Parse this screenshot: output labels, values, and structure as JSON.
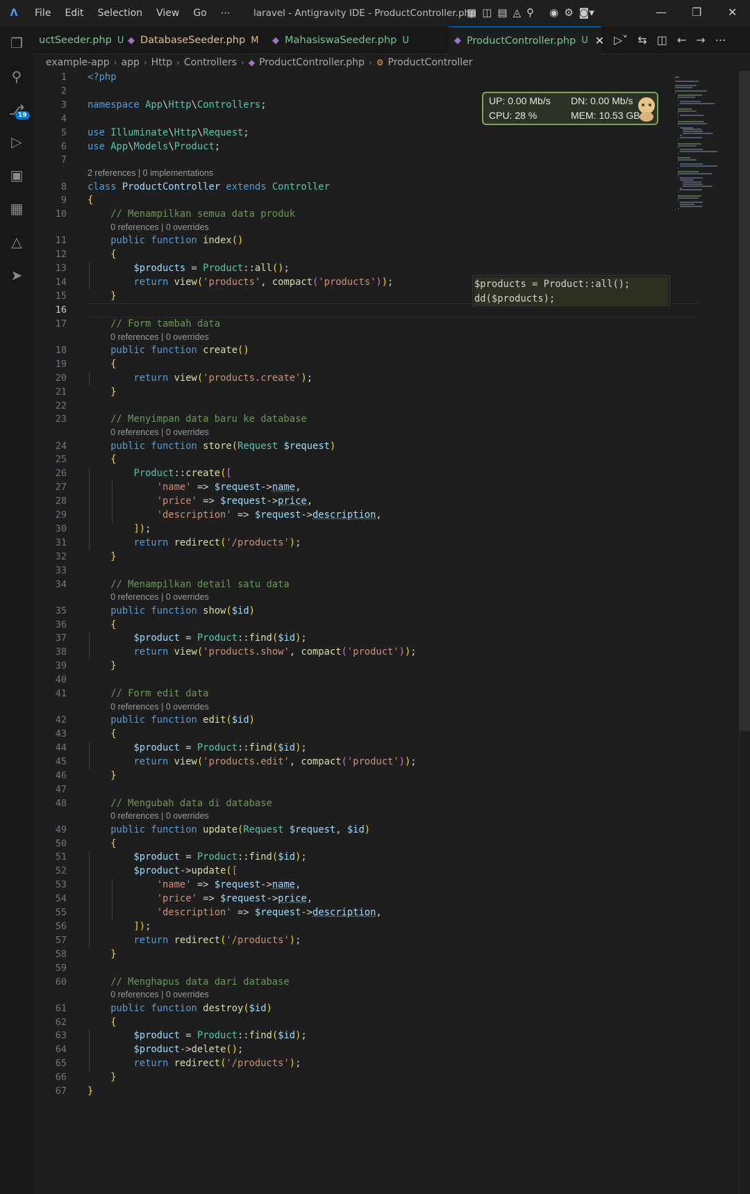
{
  "titlebar": {
    "menu": [
      "File",
      "Edit",
      "Selection",
      "View",
      "Go",
      "⋯"
    ],
    "window_title": "laravel - Antigravity IDE - ProductController.php"
  },
  "activity_bar": {
    "items": [
      "explorer-icon",
      "search-icon",
      "source-control-icon",
      "run-debug-icon",
      "remote-explorer-icon",
      "extensions-icon",
      "testing-icon",
      "deploy-icon"
    ],
    "source_control_badge": "19"
  },
  "tabs": [
    {
      "label": "uctSeeder.php",
      "status": "U",
      "status_color": "#73c991",
      "label_color": "#73c991"
    },
    {
      "label": "DatabaseSeeder.php",
      "status": "M",
      "status_color": "#e2c08d",
      "label_color": "#e2c08d"
    },
    {
      "label": "MahasiswaSeeder.php",
      "status": "U",
      "status_color": "#73c991",
      "label_color": "#73c991"
    },
    {
      "label": "ProductController.php",
      "status": "U",
      "status_color": "#73c991",
      "label_color": "#73c991",
      "active": true
    }
  ],
  "breadcrumb": [
    "example-app",
    "app",
    "Http",
    "Controllers",
    "ProductController.php",
    "ProductController"
  ],
  "code_lens": {
    "class": "2 references | 0 implementations",
    "method": "0 references | 0 overrides"
  },
  "hint_panel": {
    "line1": "$products = Product::all();",
    "line2": "dd($products);"
  },
  "system_monitor": {
    "up": "UP: 0.00 Mb/s",
    "down": "DN: 0.00 Mb/s",
    "cpu": "CPU: 28 %",
    "mem": "MEM: 10.53 GB"
  },
  "editor": {
    "current_line": 16,
    "line_numbers": [
      1,
      2,
      3,
      4,
      5,
      6,
      7,
      8,
      9,
      10,
      11,
      12,
      13,
      14,
      15,
      16,
      17,
      18,
      19,
      20,
      21,
      22,
      23,
      24,
      25,
      26,
      27,
      28,
      29,
      30,
      31,
      32,
      33,
      34,
      35,
      36,
      37,
      38,
      39,
      40,
      41,
      42,
      43,
      44,
      45,
      46,
      47,
      48,
      49,
      50,
      51,
      52,
      53,
      54,
      55,
      56,
      57,
      58,
      59,
      60,
      61,
      62,
      63,
      64,
      65,
      66,
      67
    ],
    "lines": [
      "<?php",
      "",
      "namespace App\\Http\\Controllers;",
      "",
      "use Illuminate\\Http\\Request;",
      "use App\\Models\\Product;",
      "",
      "class ProductController extends Controller",
      "{",
      "    // Menampilkan semua data produk",
      "    public function index()",
      "    {",
      "        $products = Product::all();",
      "        return view('products', compact('products'));",
      "    }",
      "",
      "    // Form tambah data",
      "    public function create()",
      "    {",
      "        return view('products.create');",
      "    }",
      "",
      "    // Menyimpan data baru ke database",
      "    public function store(Request $request)",
      "    {",
      "        Product::create([",
      "            'name' => $request->name,",
      "            'price' => $request->price,",
      "            'description' => $request->description,",
      "        ]);",
      "        return redirect('/products');",
      "    }",
      "",
      "    // Menampilkan detail satu data",
      "    public function show($id)",
      "    {",
      "        $product = Product::find($id);",
      "        return view('products.show', compact('product'));",
      "    }",
      "",
      "    // Form edit data",
      "    public function edit($id)",
      "    {",
      "        $product = Product::find($id);",
      "        return view('products.edit', compact('product'));",
      "    }",
      "",
      "    // Mengubah data di database",
      "    public function update(Request $request, $id)",
      "    {",
      "        $product = Product::find($id);",
      "        $product->update([",
      "            'name' => $request->name,",
      "            'price' => $request->price,",
      "            'description' => $request->description,",
      "        ]);",
      "        return redirect('/products');",
      "    }",
      "",
      "    // Menghapus data dari database",
      "    public function destroy($id)",
      "    {",
      "        $product = Product::find($id);",
      "        $product->delete();",
      "        return redirect('/products');",
      "    }",
      "}"
    ],
    "lens_before_lines": {
      "8": "class",
      "11": "method",
      "18": "method",
      "24": "method",
      "35": "method",
      "42": "method",
      "49": "method",
      "61": "method"
    }
  }
}
